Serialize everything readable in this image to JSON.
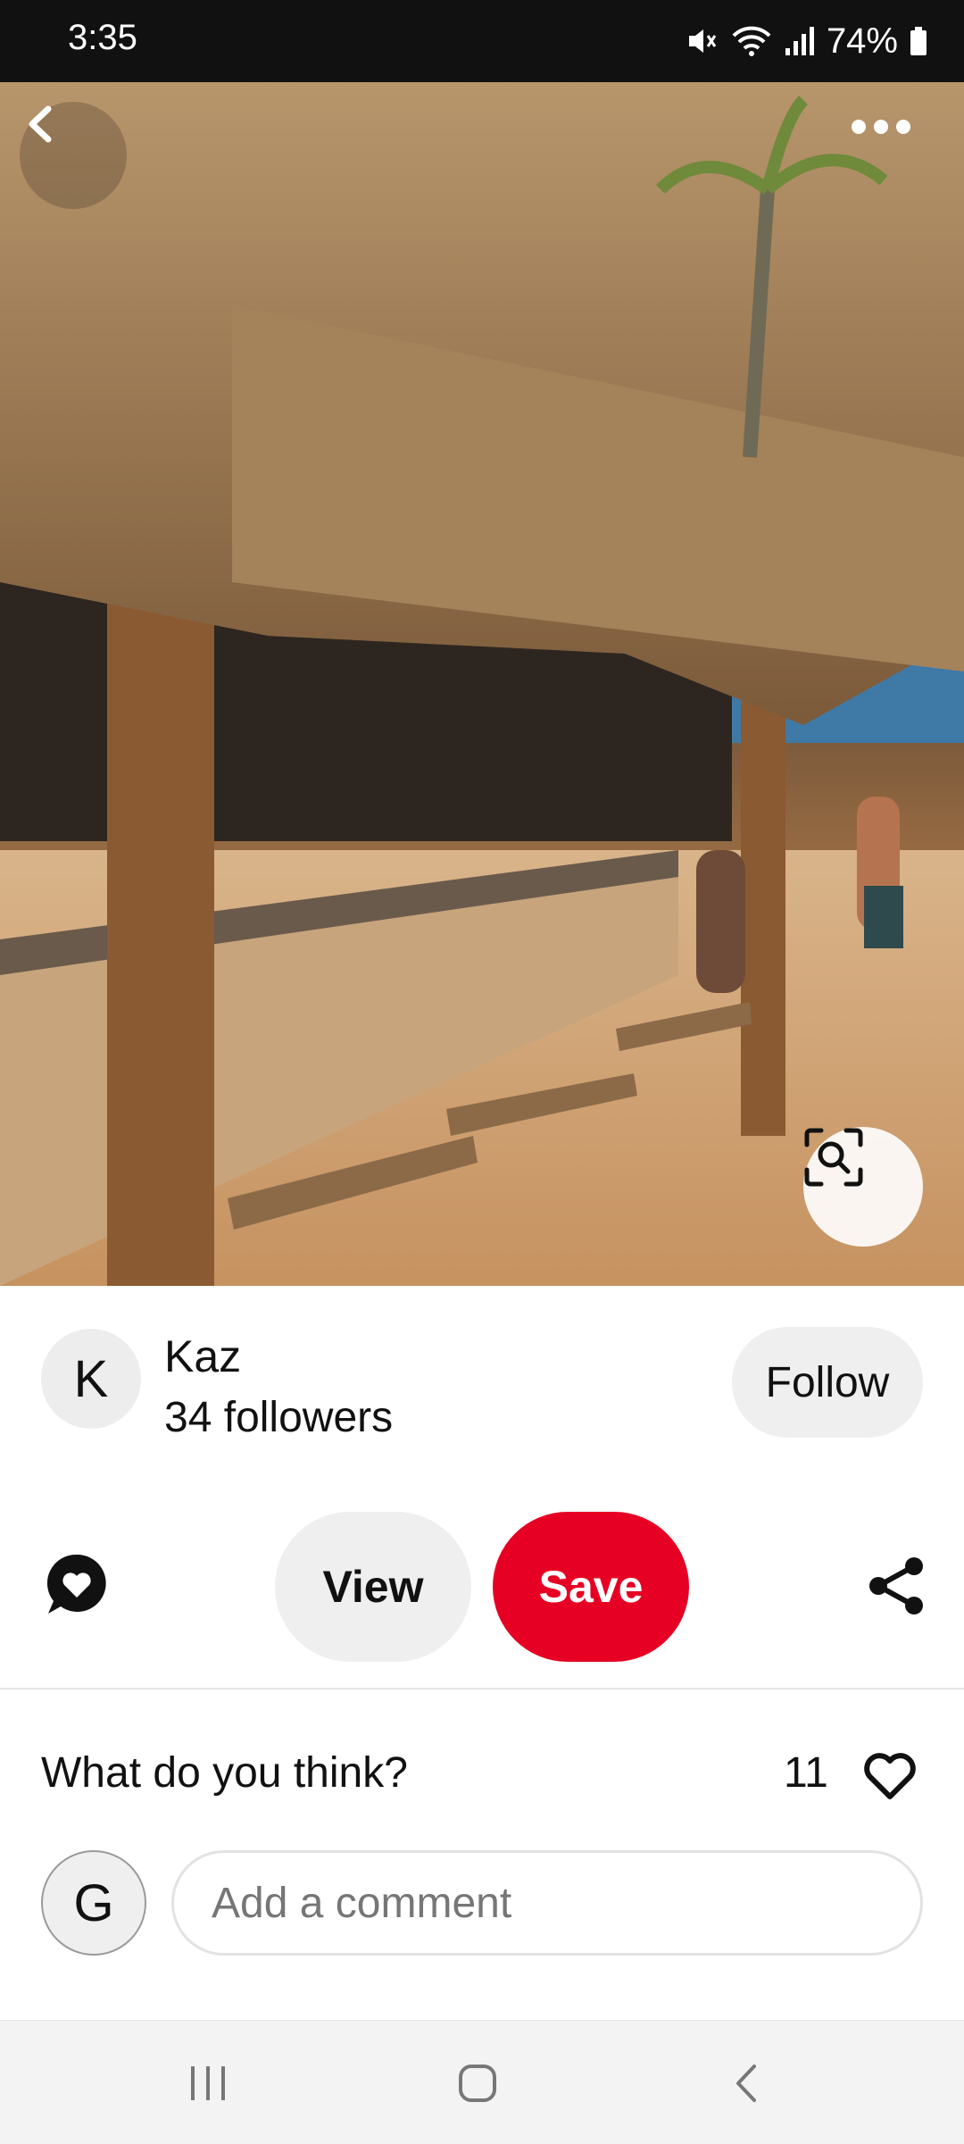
{
  "status_bar": {
    "time": "3:35",
    "battery": "74%",
    "icons": [
      "mute-icon",
      "wifi-icon",
      "signal-icon",
      "battery-icon"
    ]
  },
  "hero": {
    "icons": [
      "back-icon",
      "more-icon",
      "visual-search-icon"
    ]
  },
  "creator": {
    "avatar_letter": "K",
    "name": "Kaz",
    "followers": "34 followers",
    "follow_label": "Follow"
  },
  "actions": {
    "view_label": "View",
    "save_label": "Save",
    "icons": [
      "comment-heart-icon",
      "share-icon"
    ]
  },
  "comments": {
    "title": "What do you think?",
    "like_count": "11",
    "user_avatar_letter": "G",
    "placeholder": "Add a comment"
  },
  "nav": {
    "icons": [
      "recents-icon",
      "home-icon",
      "back-nav-icon"
    ]
  },
  "colors": {
    "save": "#e60023",
    "pill_gray": "#efefef",
    "status_bar": "#111111"
  }
}
